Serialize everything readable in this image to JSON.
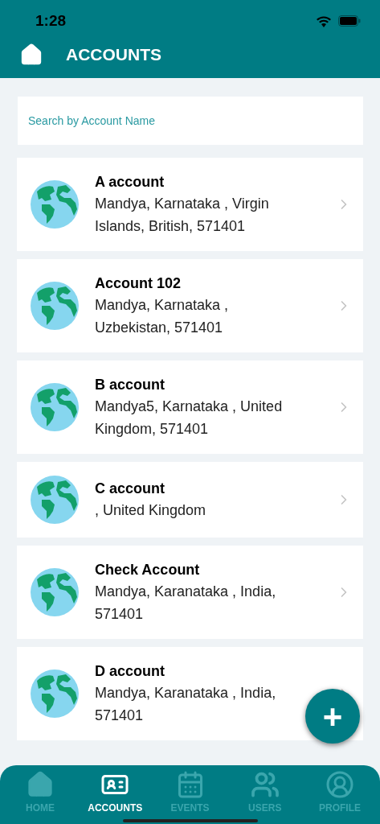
{
  "status_bar": {
    "time": "1:28"
  },
  "header": {
    "title": "ACCOUNTS"
  },
  "search": {
    "placeholder": "Search by Account Name"
  },
  "accounts": [
    {
      "name": "A account",
      "address": "Mandya, Karnataka , Virgin Islands, British, 571401"
    },
    {
      "name": "Account 102",
      "address": "Mandya, Karnataka , Uzbekistan, 571401"
    },
    {
      "name": "B account",
      "address": "Mandya5, Karnataka , United Kingdom, 571401"
    },
    {
      "name": "C account",
      "address": ", United Kingdom"
    },
    {
      "name": "Check Account",
      "address": "Mandya, Karanataka , India, 571401"
    },
    {
      "name": "D account",
      "address": "Mandya, Karanataka , India, 571401"
    }
  ],
  "fab": {
    "label": "+"
  },
  "tab_bar": [
    {
      "kind": "home",
      "label": "HOME",
      "selected": false
    },
    {
      "kind": "accounts",
      "label": "ACCOUNTS",
      "selected": true
    },
    {
      "kind": "events",
      "label": "EVENTS",
      "selected": false
    },
    {
      "kind": "users",
      "label": "USERS",
      "selected": false
    },
    {
      "kind": "profile",
      "label": "PROFILE",
      "selected": false
    }
  ]
}
